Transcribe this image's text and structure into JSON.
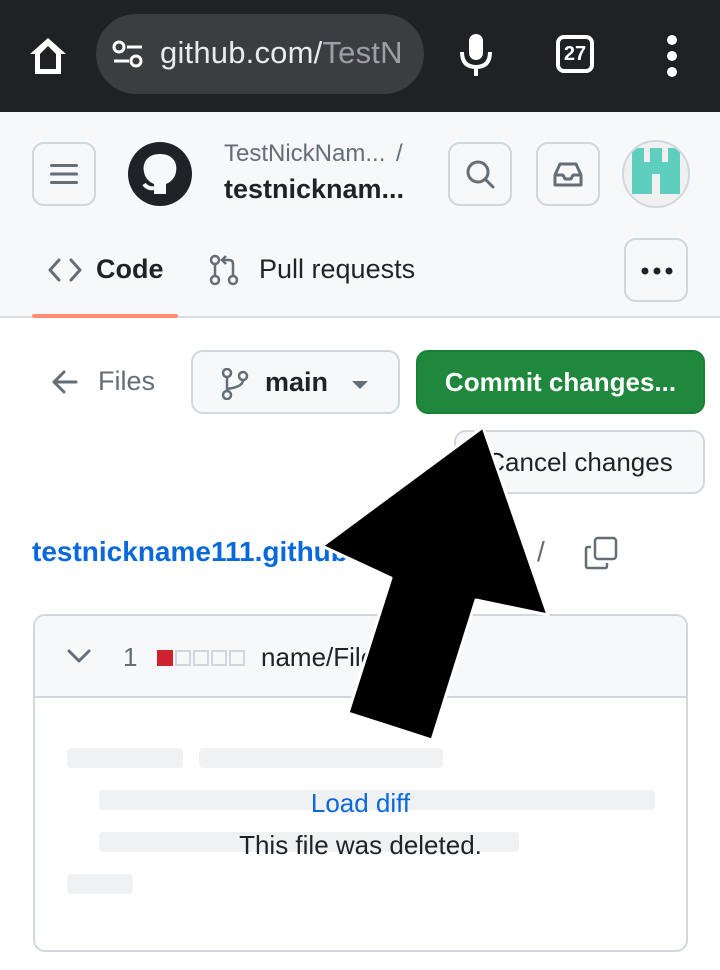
{
  "browser": {
    "url_main": "github.com/",
    "url_rest": "TestN",
    "tab_count": "27"
  },
  "header": {
    "owner": "TestNickNam...",
    "separator": "/",
    "repo": "testnicknam..."
  },
  "nav": {
    "code_label": "Code",
    "pull_requests_label": "Pull requests"
  },
  "toolbar": {
    "files_label": "Files",
    "branch_label": "main",
    "commit_label": "Commit changes...",
    "cancel_label": "Cancel changes"
  },
  "breadcrumb": {
    "root": "testnickname111.github.io",
    "separator": "/"
  },
  "diff_card": {
    "changes_count": "1",
    "path": "name/File",
    "load_diff_label": "Load diff",
    "deleted_message": "This file was deleted.",
    "diffstat": [
      "deleted",
      "neutral",
      "neutral",
      "neutral",
      "neutral"
    ]
  },
  "colors": {
    "commit_green": "#1f883d",
    "link_blue": "#0969da",
    "tab_underline": "#fd8c73",
    "deletion_red": "#cf222e"
  }
}
